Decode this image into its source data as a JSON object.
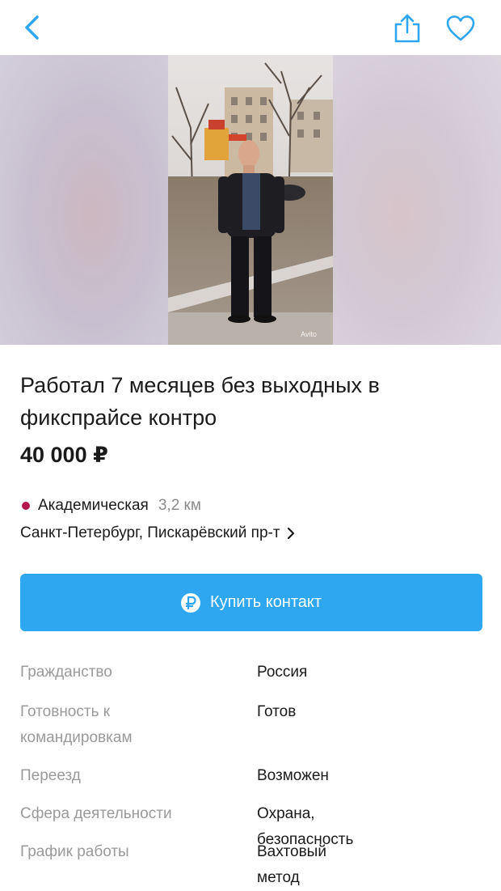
{
  "topbar": {
    "back_icon": "chevron-left-icon",
    "share_icon": "share-icon",
    "favorite_icon": "heart-icon",
    "accent_color": "#2fa6f0"
  },
  "gallery": {
    "watermark": "Avito"
  },
  "listing": {
    "title": "Работал 7 месяцев без выходных в фикспрайсе контро",
    "price": "40 000 ₽"
  },
  "location": {
    "metro_station": "Академическая",
    "metro_distance": "3,2 км",
    "metro_color": "#b3174d",
    "address": "Санкт-Петербург, Пискарёвский пр-т"
  },
  "actions": {
    "buy_contact_label": "Купить контакт",
    "buy_icon_glyph": "₽"
  },
  "params": [
    {
      "label": "Гражданство",
      "value": "Россия"
    },
    {
      "label": "Готовность к командировкам",
      "value": "Готов"
    },
    {
      "label": "Переезд",
      "value": "Возможен"
    },
    {
      "label": "Сфера деятельности",
      "value": "Охрана, безопасность"
    },
    {
      "label": "График работы",
      "value": "Вахтовый метод"
    }
  ]
}
